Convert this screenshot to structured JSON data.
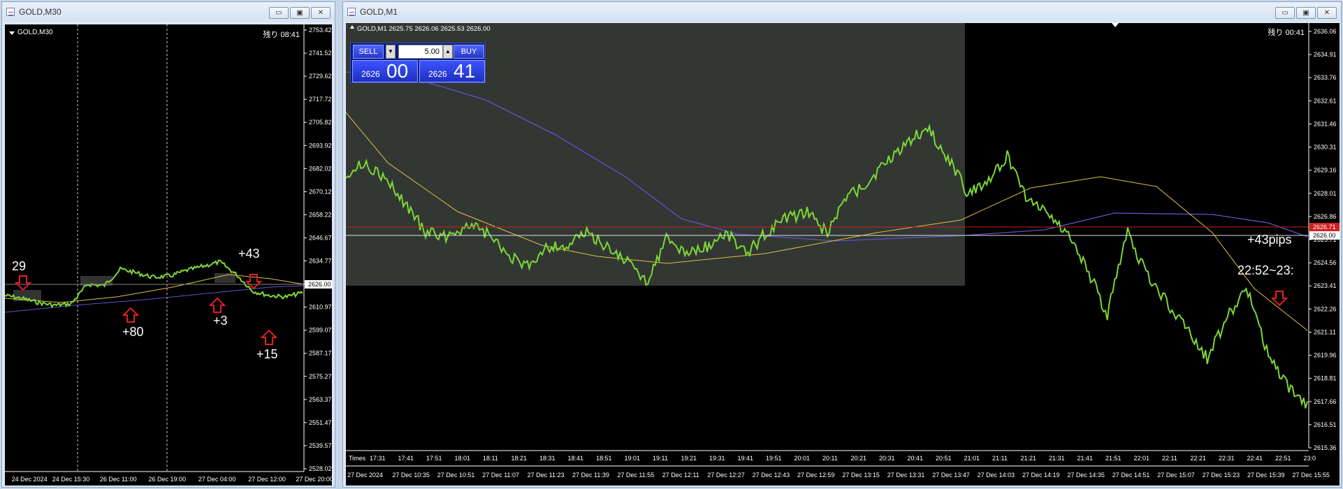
{
  "left_window": {
    "title": "GOLD,M30",
    "controls": [
      "▭",
      "▣",
      "✕"
    ],
    "symbol_label": "GOLD,M30",
    "timer_label": "残り 08:41",
    "price_scale": [
      "2753.42",
      "2741.52",
      "2729.62",
      "2717.72",
      "2705.82",
      "2693.92",
      "2682.02",
      "2670.12",
      "2658.22",
      "2646.67",
      "2634.77",
      "2622.87",
      "2610.97",
      "2599.07",
      "2587.17",
      "2575.27",
      "2563.37",
      "2551.47",
      "2539.57",
      "2528.02"
    ],
    "current_price": "2626.00",
    "time_scale": [
      "24 Dec 2024",
      "24 Dec 15:30",
      "26 Dec 11:00",
      "26 Dec 19:00",
      "27 Dec 04:00",
      "27 Dec 12:00",
      "27 Dec 20:00"
    ],
    "annotations": [
      "29",
      "+80",
      "+3",
      "+43",
      "+15"
    ]
  },
  "right_window": {
    "title": "GOLD,M1",
    "controls": [
      "▭",
      "▣",
      "✕"
    ],
    "symbol_label": "GOLD,M1  2625.75 2626.06 2625.53 2626.00",
    "timer_label": "残り 00:41",
    "one_click": {
      "sell": "SELL",
      "buy": "BUY",
      "lot": "5.00",
      "sell_small": "2626",
      "sell_big": "00",
      "buy_small": "2626",
      "buy_big": "41",
      "up": "▲",
      "down": "▼"
    },
    "price_scale": [
      "2636.06",
      "2634.91",
      "2633.76",
      "2632.61",
      "2631.46",
      "2630.31",
      "2629.16",
      "2628.01",
      "2626.86",
      "2625.71",
      "2624.56",
      "2623.41",
      "2622.26",
      "2621.11",
      "2619.96",
      "2618.81",
      "2617.66",
      "2616.51",
      "2615.36"
    ],
    "price_marks": {
      "red": "2626.71",
      "white": "2626.00"
    },
    "inner_time_scale": [
      "17:31",
      "17:41",
      "17:51",
      "18:01",
      "18:11",
      "18:21",
      "18:31",
      "18:41",
      "18:51",
      "19:01",
      "19:11",
      "19:21",
      "19:31",
      "19:41",
      "19:51",
      "20:01",
      "20:11",
      "20:21",
      "20:31",
      "20:41",
      "20:51",
      "21:01",
      "21:11",
      "21:21",
      "21:31",
      "21:41",
      "21:51",
      "22:01",
      "22:11",
      "22:21",
      "22:31",
      "22:41",
      "22:51",
      "23:0"
    ],
    "inner_label": "Times",
    "time_scale": [
      "27 Dec 2024",
      "27 Dec 10:35",
      "27 Dec 10:51",
      "27 Dec 11:07",
      "27 Dec 11:23",
      "27 Dec 11:39",
      "27 Dec 11:55",
      "27 Dec 12:11",
      "27 Dec 12:27",
      "27 Dec 12:43",
      "27 Dec 12:59",
      "27 Dec 13:15",
      "27 Dec 13:31",
      "27 Dec 13:47",
      "27 Dec 14:03",
      "27 Dec 14:19",
      "27 Dec 14:35",
      "27 Dec 14:51",
      "27 Dec 15:07",
      "27 Dec 15:23",
      "27 Dec 15:39",
      "27 Dec 15:55"
    ],
    "annotations": [
      "+43pips",
      "22:52~23:"
    ]
  },
  "colors": {
    "candle": "#7cd836",
    "ma_fast": "#e0c040",
    "ma_slow": "#5b55c8",
    "arrow": "#e02020",
    "red_line": "#d02020"
  }
}
